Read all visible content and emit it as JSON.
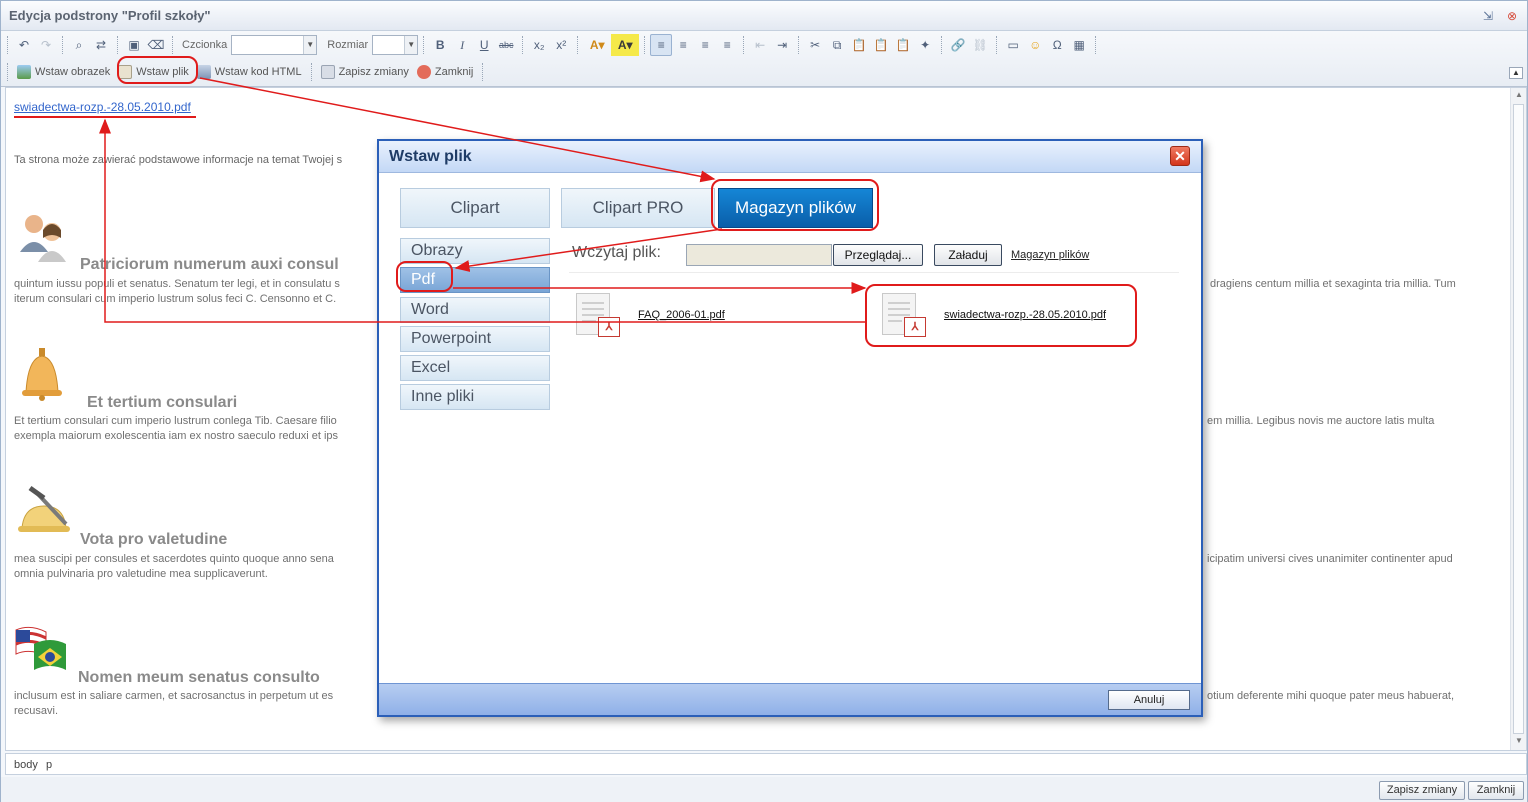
{
  "window": {
    "title": "Edycja podstrony \"Profil szkoły\""
  },
  "toolbar": {
    "font_label": "Czcionka",
    "font_value": "",
    "size_label": "Rozmiar",
    "size_value": "",
    "insert_image": "Wstaw obrazek",
    "insert_file": "Wstaw plik",
    "insert_html": "Wstaw kod HTML",
    "save_changes": "Zapisz zmiany",
    "close": "Zamknij"
  },
  "editor": {
    "link_text": "swiadectwa-rozp.-28.05.2010.pdf",
    "intro": "Ta strona może zawierać podstawowe informacje na temat Twojej s",
    "sections": [
      {
        "icon": "people-icon",
        "title": "Patriciorum numerum auxi consul",
        "line1": "quintum iussu populi et senatus. Senatum ter legi, et in consulatu s",
        "line1_right": "dragiens centum millia et sexaginta tria millia. Tum",
        "line2": "iterum consulari cum imperio lustrum solus feci C. Censonno et C.",
        "line2_right": ""
      },
      {
        "icon": "bell-icon",
        "title": "Et tertium consulari",
        "line1": "Et tertium consulari cum imperio lustrum conlega Tib. Caesare filio",
        "line1_right": "em millia. Legibus novis me auctore latis multa",
        "line2": "exempla maiorum exolescentia iam ex nostro saeculo reduxi et ips",
        "line2_right": ""
      },
      {
        "icon": "helmet-pickaxe-icon",
        "title": "Vota pro valetudine",
        "line1": "mea suscipi per consules et sacerdotes quinto quoque anno sena",
        "line1_right": "icipatim universi cives unanimiter continenter apud",
        "line2": "omnia pulvinaria pro valetudine mea supplicaverunt.",
        "line2_right": ""
      },
      {
        "icon": "flags-icon",
        "title": "Nomen meum senatus consulto",
        "line1": "inclusum est in saliare carmen, et sacrosanctus in perpetum ut es",
        "line1_right": "otium deferente mihi quoque pater meus habuerat,",
        "line2": "recusavi.",
        "line2_right": ""
      }
    ]
  },
  "statusbar": {
    "path1": "body",
    "path2": "p"
  },
  "bottom": {
    "save": "Zapisz zmiany",
    "close": "Zamknij"
  },
  "dialog": {
    "title": "Wstaw plik",
    "close_symbol": "✕",
    "tabs": [
      "Clipart",
      "Clipart PRO",
      "Magazyn plików"
    ],
    "selected_tab": "Magazyn plików",
    "categories": [
      "Obrazy",
      "Pdf",
      "Word",
      "Powerpoint",
      "Excel",
      "Inne pliki"
    ],
    "selected_category": "Pdf",
    "upload_label": "Wczytaj plik:",
    "upload_value": "",
    "browse_button": "Przeglądaj...",
    "upload_button": "Załaduj",
    "storage_link": "Magazyn plików",
    "files": [
      {
        "name": "FAQ_2006-01.pdf",
        "type": "pdf"
      },
      {
        "name": "swiadectwa-rozp.-28.05.2010.pdf",
        "type": "pdf"
      }
    ],
    "cancel_button": "Anuluj"
  },
  "colors": {
    "accent_blue": "#0a5ea9",
    "annotation_red": "#e01b1b",
    "dialog_border": "#2b5fb8"
  }
}
